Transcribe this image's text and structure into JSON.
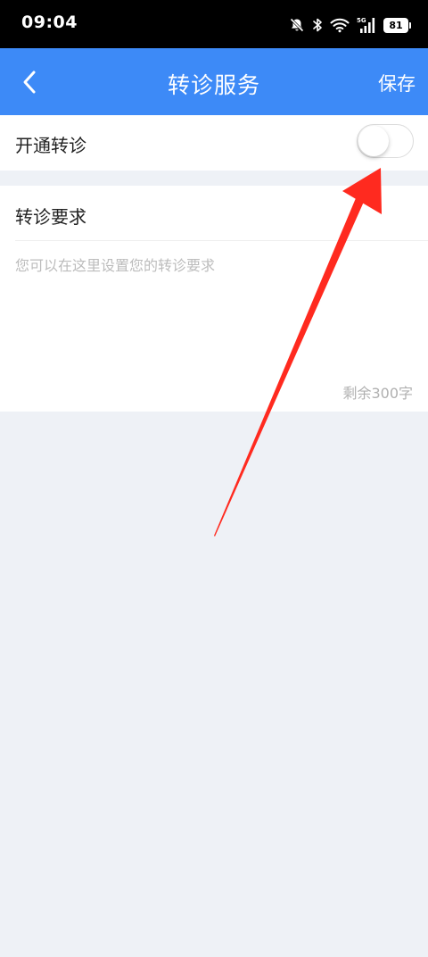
{
  "status_bar": {
    "time": "09:04",
    "network_label": "5G",
    "battery_level": "81",
    "icons": [
      "mute-icon",
      "bluetooth-icon",
      "wifi-icon",
      "signal-icon",
      "battery-icon"
    ]
  },
  "nav": {
    "back_icon": "chevron-left-icon",
    "title": "转诊服务",
    "save_label": "保存"
  },
  "referral_toggle": {
    "label": "开通转诊",
    "enabled": false
  },
  "requirements": {
    "title": "转诊要求",
    "value": "",
    "placeholder": "您可以在这里设置您的转诊要求",
    "remaining_text": "剩余300字"
  },
  "colors": {
    "nav_background": "#3d8af7",
    "page_background": "#eef1f6",
    "annotation_arrow": "#ff2a1f"
  }
}
